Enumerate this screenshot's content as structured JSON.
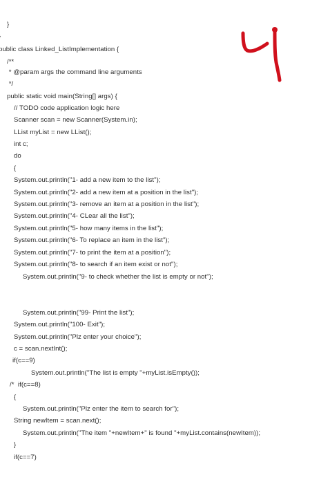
{
  "document": {
    "lines": [
      "}",
      "}",
      "public class Linked_ListImplementation {",
      "/**",
      " * @param args the command line arguments",
      " */",
      "public static void main(String[] args) {",
      "// TODO code application logic here",
      "Scanner scan = new Scanner(System.in);",
      "LList myList = new LList();",
      "int c;",
      "do",
      "{",
      "System.out.println(\"1- add a new item to the list\");",
      "System.out.println(\"2- add a new item at a position in the list\");",
      "System.out.println(\"3- remove an item at a position in the list\");",
      "System.out.println(\"4- CLear all the list\");",
      "System.out.println(\"5- how many items in the list\");",
      "System.out.println(\"6- To replace an item in the list\");",
      "System.out.println(\"7- to print the item at a position\");",
      "System.out.println(\"8- to search if an item exist or not\");",
      "System.out.println(\"9- to check whether the list is empty or not\");",
      "System.out.println(\"99- Print the list\");",
      "System.out.println(\"100- Exit\");",
      "System.out.println(\"Plz enter your choice\");",
      "c = scan.nextInt();",
      "if(c==9)",
      "System.out.println(\"The list is empty \"+myList.isEmpty());",
      "/*  if(c==8)",
      "{",
      "System.out.println(\"Plz enter the item to search for\");",
      "String newItem = scan.next();",
      "System.out.println(\"The item \"+newItem+\" is found \"+myList.contains(newItem));",
      "}",
      "if(c==7)"
    ]
  },
  "annotation": {
    "handwritten_number": "4",
    "color": "#d0101c"
  }
}
